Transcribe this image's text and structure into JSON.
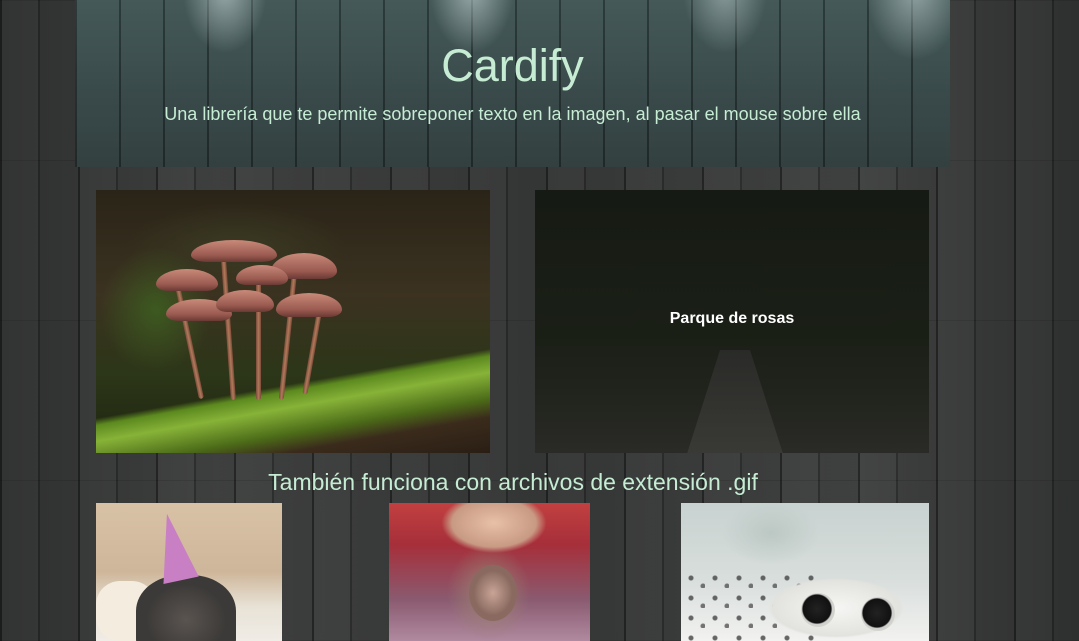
{
  "header": {
    "title": "Cardify",
    "subtitle": "Una librería que te permite sobreponer texto en la imagen, al pasar el mouse sobre ella"
  },
  "cards": [
    {
      "image": "mushrooms-on-moss-photo",
      "overlay_text": ""
    },
    {
      "image": "rose-park-path-photo",
      "overlay_text": "Parque de rosas"
    }
  ],
  "gif_section": {
    "title": "También funciona con archivos de extensión .gif",
    "gifs": [
      {
        "image": "cat-with-party-hat-gif"
      },
      {
        "image": "monkey-massage-gif"
      },
      {
        "image": "gecko-gif"
      }
    ]
  },
  "colors": {
    "accent_text": "#c6ecd4",
    "overlay_text": "#ffffff",
    "background": "#2e3030"
  }
}
